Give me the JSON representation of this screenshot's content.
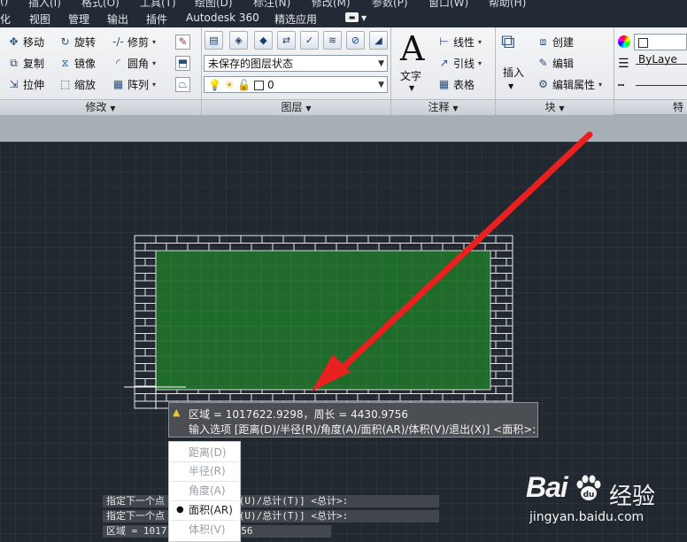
{
  "menubar": {
    "items": [
      "()",
      "插入(I)",
      "格式(O)",
      "工具(T)",
      "绘图(D)",
      "标注(N)",
      "修改(M)",
      "参数(P)",
      "窗口(W)",
      "帮助(H)"
    ]
  },
  "tabs": {
    "items": [
      "化",
      "视图",
      "管理",
      "输出",
      "插件",
      "Autodesk 360",
      "精选应用"
    ],
    "badge": "▬"
  },
  "ribbon": {
    "modify": {
      "title": "修改",
      "move": "移动",
      "rotate": "旋转",
      "trim": "修剪",
      "copy": "复制",
      "mirror": "镜像",
      "fillet": "圆角",
      "stretch": "拉伸",
      "scale": "缩放",
      "array": "阵列"
    },
    "layers": {
      "title": "图层",
      "layer_state": "未保存的图层状态",
      "current_layer": "0"
    },
    "annotation": {
      "title": "注释",
      "text": "文字",
      "linear": "线性",
      "leader": "引线",
      "table": "表格"
    },
    "block": {
      "title": "块",
      "insert": "插入",
      "create": "创建",
      "edit": "编辑",
      "edit_attributes": "编辑属性"
    },
    "properties": {
      "title": "特",
      "color_value": "ByLaye"
    }
  },
  "tooltip": {
    "line1": "区域 = 1017622.9298，周长 = 4430.9756",
    "line2": "输入选项 [距离(D)/半径(R)/角度(A)/面积(AR)/体积(V)/退出(X)] <面积>:"
  },
  "dynamic_menu": {
    "items": [
      "距离(D)",
      "半径(R)",
      "角度(A)",
      "面积(AR)",
      "体积(V)"
    ],
    "selected_index": 3
  },
  "command_history": {
    "lines": [
      "指定下一个点                /长度(L)/放弃(U)/总计(T)] <总计>:",
      "指定下一个点                /长度(L)/放弃(U)/总计(T)] <总计>:",
      "区域 = 1017            长 = 4430.9756"
    ]
  },
  "watermark": {
    "logo": "Bai",
    "logo_suffix": "du",
    "cn": "经验",
    "url": "jingyan.baidu.com"
  },
  "colors": {
    "canvas": "#212830",
    "hatch_fill": "#1f6b2a",
    "brick_lines": "#e6e6e6",
    "arrow": "#e8201f",
    "ribbon": "#e8ebee"
  }
}
